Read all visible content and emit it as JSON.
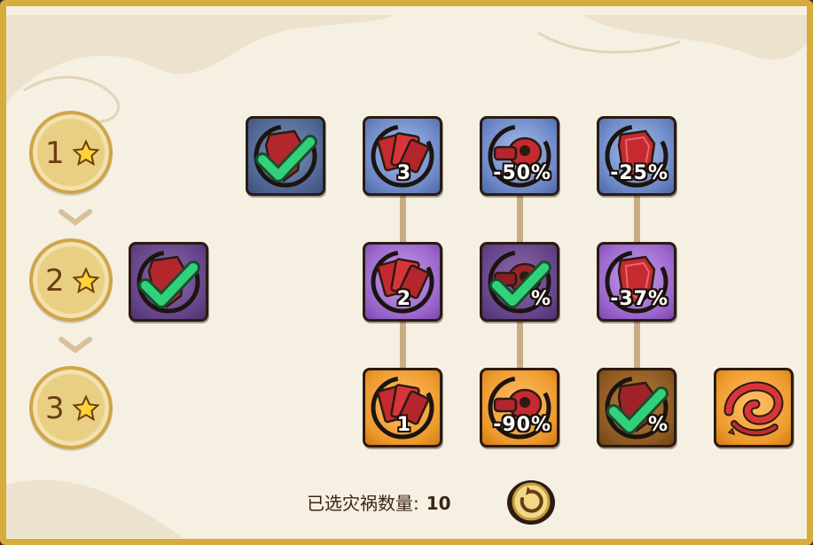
{
  "tiers": [
    {
      "label": "1",
      "star_icon": "star-icon"
    },
    {
      "label": "2",
      "star_icon": "star-icon"
    },
    {
      "label": "3",
      "star_icon": "star-icon"
    }
  ],
  "nodes": {
    "t1_selected": {
      "icon": "red-shield-icon",
      "value": "",
      "selected": true
    },
    "t2_selected": {
      "icon": "red-shield-icon",
      "value": "",
      "selected": true
    },
    "cards_t1": {
      "icon": "red-cards-icon",
      "value": "3"
    },
    "cards_t2": {
      "icon": "red-cards-icon",
      "value": "2"
    },
    "cards_t3": {
      "icon": "red-cards-icon",
      "value": "1"
    },
    "cannon_t1": {
      "icon": "red-cannon-icon",
      "value": "-50%"
    },
    "cannon_t2": {
      "icon": "red-cannon-icon",
      "value": "%",
      "selected": true
    },
    "cannon_t3": {
      "icon": "red-cannon-icon",
      "value": "-90%"
    },
    "shield_t1": {
      "icon": "red-shield-icon",
      "value": "-25%"
    },
    "shield_t2": {
      "icon": "red-shield-icon",
      "value": "-37%"
    },
    "shield_t3": {
      "icon": "red-shield-icon",
      "value": "%",
      "selected": true
    },
    "vortex_t3": {
      "icon": "red-vortex-icon",
      "value": ""
    }
  },
  "footer": {
    "count_label": "已选灾祸数量:",
    "count_value": "10",
    "reset_icon": "reset-icon"
  },
  "colors": {
    "tier1": "#6b88c6",
    "tier2": "#9a66cc",
    "tier3": "#ee9a2c",
    "check": "#2fc46a",
    "frame": "#d6ac3d",
    "panel": "#f6f0e2"
  }
}
